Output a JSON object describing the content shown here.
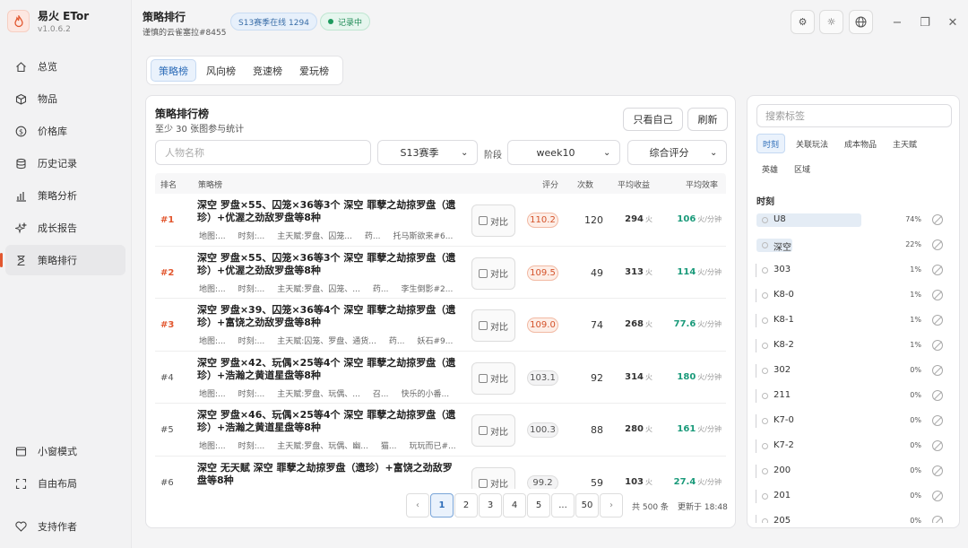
{
  "app": {
    "name": "易火 ETor",
    "version": "v1.0.6.2"
  },
  "header": {
    "title": "策略排行",
    "subtitle": "谨慎的云雀塞拉#8455",
    "season_badge": "S13赛季在线 1294",
    "status_badge": "记录中"
  },
  "sidebar": {
    "items": [
      {
        "label": "总览",
        "icon": "home-icon"
      },
      {
        "label": "物品",
        "icon": "box-icon"
      },
      {
        "label": "价格库",
        "icon": "dollar-icon"
      },
      {
        "label": "历史记录",
        "icon": "database-icon"
      },
      {
        "label": "策略分析",
        "icon": "bar-chart-icon"
      },
      {
        "label": "成长报告",
        "icon": "sparkle-icon"
      },
      {
        "label": "策略排行",
        "icon": "hourglass-icon",
        "active": true
      }
    ],
    "bottom": [
      {
        "label": "小窗模式",
        "icon": "window-icon"
      },
      {
        "label": "自由布局",
        "icon": "expand-icon"
      }
    ],
    "support": {
      "label": "支持作者",
      "icon": "heart-icon"
    }
  },
  "tabs": [
    {
      "label": "策略榜",
      "active": true
    },
    {
      "label": "风向榜"
    },
    {
      "label": "竞速榜"
    },
    {
      "label": "爱玩榜"
    }
  ],
  "board": {
    "title": "策略排行榜",
    "subtitle": "至少 30 张图参与统计",
    "only_mine": "只看自己",
    "refresh": "刷新",
    "name_placeholder": "人物名称",
    "season": "S13赛季",
    "stage_label": "阶段",
    "stage": "week10",
    "sort": "综合评分",
    "columns": {
      "rank": "排名",
      "strategy": "策略榜",
      "score": "评分",
      "count": "次数",
      "avg_income": "平均收益",
      "avg_eff": "平均效率"
    },
    "compare_label": "对比",
    "income_unit": "火",
    "eff_unit": "火/分钟",
    "rows": [
      {
        "rank": "#1",
        "strategy": "深空 罗盘×55、囚笼×36等3个 深空 罪孽之劫掠罗盘（遗珍）+优渥之劲敌罗盘等8种",
        "meta": [
          "地图:...",
          "时刻:...",
          "主天赋:罗盘、囚笼...",
          "药...",
          "托马斯欲来#6..."
        ],
        "score": "110.2",
        "hi": true,
        "count": "120",
        "income": "294",
        "eff": "106"
      },
      {
        "rank": "#2",
        "strategy": "深空 罗盘×55、囚笼×36等3个 深空 罪孽之劫掠罗盘（遗珍）+优渥之劲敌罗盘等8种",
        "meta": [
          "地图:...",
          "时刻:...",
          "主天赋:罗盘、囚笼、...",
          "药...",
          "李生倒影#2..."
        ],
        "score": "109.5",
        "hi": true,
        "count": "49",
        "income": "313",
        "eff": "114"
      },
      {
        "rank": "#3",
        "strategy": "深空 罗盘×39、囚笼×36等4个 深空 罪孽之劫掠罗盘（遗珍）+富饶之劲敌罗盘等8种",
        "meta": [
          "地图:...",
          "时刻:...",
          "主天赋:囚笼、罗盘、通货...",
          "药...",
          "妖石#9..."
        ],
        "score": "109.0",
        "hi": true,
        "count": "74",
        "income": "268",
        "eff": "77.6"
      },
      {
        "rank": "#4",
        "strategy": "深空 罗盘×42、玩偶×25等4个 深空 罪孽之劫掠罗盘（遗珍）+浩瀚之黄道星盘等8种",
        "meta": [
          "地图:...",
          "时刻:...",
          "主天赋:罗盘、玩偶、...",
          "召...",
          "快乐的小番..."
        ],
        "score": "103.1",
        "hi": false,
        "count": "92",
        "income": "314",
        "eff": "180"
      },
      {
        "rank": "#5",
        "strategy": "深空 罗盘×46、玩偶×25等4个 深空 罪孽之劫掠罗盘（遗珍）+浩瀚之黄道星盘等8种",
        "meta": [
          "地图:...",
          "时刻:...",
          "主天赋:罗盘、玩偶、幽...",
          "猫...",
          "玩玩而已#..."
        ],
        "score": "100.3",
        "hi": false,
        "count": "88",
        "income": "280",
        "eff": "161"
      },
      {
        "rank": "#6",
        "strategy": "深空 无天赋 深空 罪孽之劫掠罗盘（遗珍）+富饶之劲敌罗盘等8种",
        "meta": [],
        "score": "99.2",
        "hi": false,
        "count": "59",
        "income": "103",
        "eff": "27.4"
      }
    ],
    "pager": {
      "prev": "‹",
      "pages": [
        "1",
        "2",
        "3",
        "4",
        "5",
        "...",
        "50"
      ],
      "next": "›",
      "total": "共 500 条",
      "updated": "更新于 18:48"
    }
  },
  "tags_panel": {
    "search_placeholder": "搜索标签",
    "tabs_row1": [
      "时刻",
      "关联玩法",
      "成本物品",
      "主天赋"
    ],
    "tabs_row2": [
      "英雄",
      "区域"
    ],
    "section": "时刻",
    "items": [
      {
        "name": "U8",
        "pct": "74%",
        "share": 0.74
      },
      {
        "name": "深空",
        "pct": "22%",
        "share": 0.22
      },
      {
        "name": "303",
        "pct": "1%",
        "share": 0
      },
      {
        "name": "K8-0",
        "pct": "1%",
        "share": 0
      },
      {
        "name": "K8-1",
        "pct": "1%",
        "share": 0
      },
      {
        "name": "K8-2",
        "pct": "1%",
        "share": 0
      },
      {
        "name": "302",
        "pct": "0%",
        "share": 0
      },
      {
        "name": "211",
        "pct": "0%",
        "share": 0
      },
      {
        "name": "K7-0",
        "pct": "0%",
        "share": 0
      },
      {
        "name": "K7-2",
        "pct": "0%",
        "share": 0
      },
      {
        "name": "200",
        "pct": "0%",
        "share": 0
      },
      {
        "name": "201",
        "pct": "0%",
        "share": 0
      },
      {
        "name": "205",
        "pct": "0%",
        "share": 0
      }
    ]
  },
  "colors": {
    "accent": "#e2572f",
    "blue": "#2c6cb8",
    "green": "#1a9a7a"
  }
}
